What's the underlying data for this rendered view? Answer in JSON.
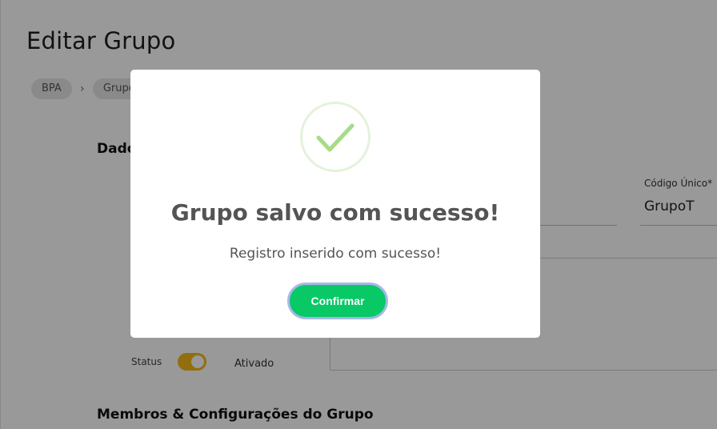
{
  "page": {
    "title": "Editar Grupo",
    "breadcrumb": [
      "BPA",
      "Grupo"
    ],
    "section_data_title": "Dados",
    "section_members_title": "Membros & Configurações do Grupo",
    "unique_code": {
      "label": "Código Único*",
      "value": "GrupoT"
    },
    "status": {
      "label": "Status",
      "value": "Ativado",
      "enabled": true
    }
  },
  "modal": {
    "title": "Grupo salvo com sucesso!",
    "message": "Registro inserido com sucesso!",
    "confirm_label": "Confirmar",
    "icon": "check-icon"
  },
  "colors": {
    "overlay": "rgba(0,0,0,0.4)",
    "success_green": "#08c966",
    "check_stroke": "#a5dc86",
    "toggle_on": "#f3b815",
    "focus_ring": "#a7b8e8"
  }
}
